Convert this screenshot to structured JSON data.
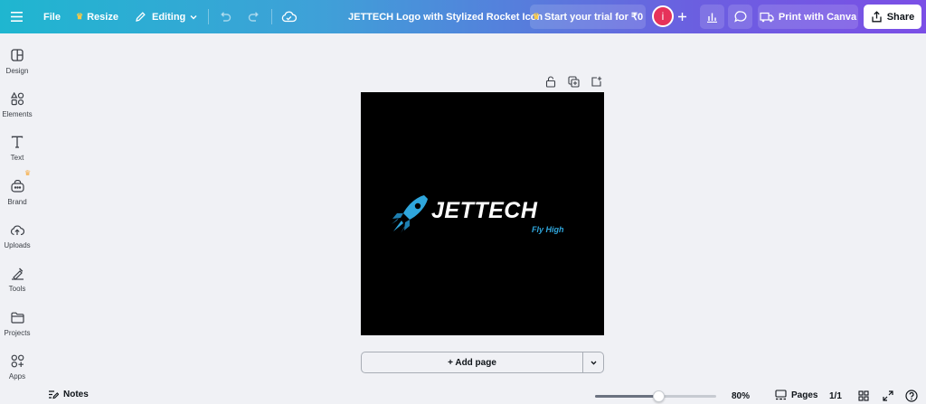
{
  "topbar": {
    "file_label": "File",
    "resize_label": "Resize",
    "editing_label": "Editing",
    "doc_title": "JETTECH Logo with Stylized Rocket Icon",
    "trial_label": "Start your trial for ₹0",
    "avatar_initial": "i",
    "print_label": "Print with Canva",
    "share_label": "Share"
  },
  "sidebar": {
    "items": [
      {
        "label": "Design",
        "icon": "design-icon"
      },
      {
        "label": "Elements",
        "icon": "elements-icon"
      },
      {
        "label": "Text",
        "icon": "text-icon"
      },
      {
        "label": "Brand",
        "icon": "brand-icon"
      },
      {
        "label": "Uploads",
        "icon": "uploads-icon"
      },
      {
        "label": "Tools",
        "icon": "tools-icon"
      },
      {
        "label": "Projects",
        "icon": "folder-icon"
      },
      {
        "label": "Apps",
        "icon": "apps-icon"
      }
    ]
  },
  "canvas": {
    "logo_title": "JETTECH",
    "logo_tagline": "Fly High",
    "add_page_label": "+ Add page"
  },
  "bottombar": {
    "notes_label": "Notes",
    "zoom_value": 80,
    "zoom_label": "80%",
    "pages_label": "Pages",
    "page_count": "1/1"
  },
  "colors": {
    "gradient_start": "#1fb6d0",
    "gradient_end": "#7b4fe6",
    "logo_accent": "#2fa6dc",
    "avatar": "#e6325a",
    "crown": "#f7c948"
  }
}
